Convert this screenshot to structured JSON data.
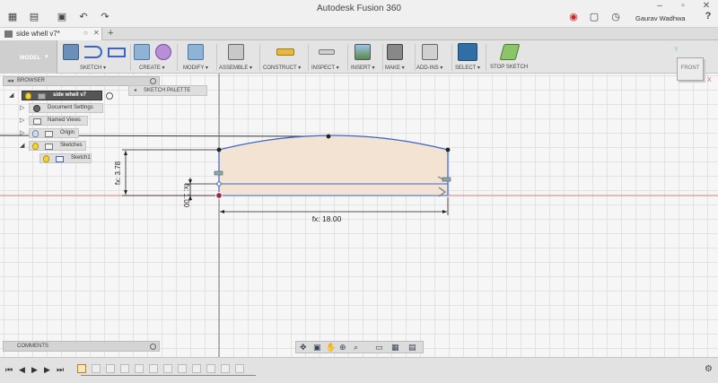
{
  "window": {
    "title": "Autodesk Fusion 360",
    "user": "Gaurav Wadhwa"
  },
  "tab": {
    "label": "side whell v7*"
  },
  "workspace": {
    "label": "MODEL"
  },
  "toolbar": {
    "groups": [
      {
        "label": "SKETCH ▾"
      },
      {
        "label": "CREATE ▾"
      },
      {
        "label": "MODIFY ▾"
      },
      {
        "label": "ASSEMBLE ▾"
      },
      {
        "label": "CONSTRUCT ▾"
      },
      {
        "label": "INSPECT ▾"
      },
      {
        "label": "INSERT ▾"
      },
      {
        "label": "MAKE ▾"
      },
      {
        "label": "ADD-INS ▾"
      },
      {
        "label": "SELECT ▾"
      },
      {
        "label": "STOP SKETCH"
      }
    ]
  },
  "browser": {
    "title": "BROWSER",
    "root": "side whell v7",
    "items": [
      {
        "label": "Document Settings"
      },
      {
        "label": "Named Views"
      },
      {
        "label": "Origin"
      },
      {
        "label": "Sketches"
      },
      {
        "label": "Sketch1"
      }
    ]
  },
  "sketch_palette": {
    "label": "SKETCH PALETTE"
  },
  "viewcube": {
    "face": "FRONT",
    "axis_y": "Y",
    "axis_x": "X"
  },
  "dimensions": {
    "height": "fx: 3.78",
    "small": "fx: 1.00",
    "width": "fx: 18.00"
  },
  "comments": {
    "label": "COMMENTS"
  },
  "colors": {
    "sketch_line": "#3b64c8",
    "profile_fill": "#f3e3d2",
    "x_axis": "#d98080",
    "accent_select": "#2f6fa5"
  }
}
